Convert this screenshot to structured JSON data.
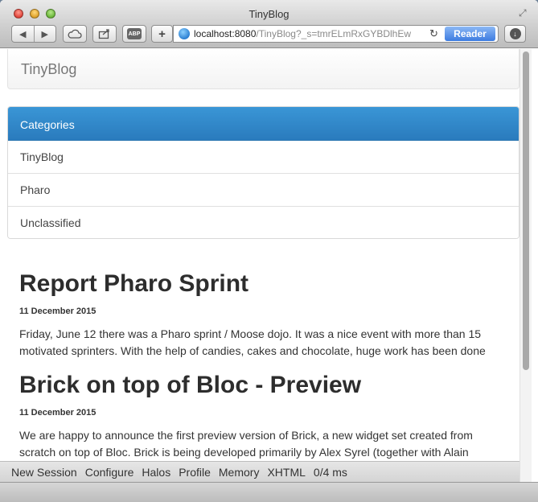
{
  "window": {
    "title": "TinyBlog"
  },
  "toolbar": {
    "url_host": "localhost:8080",
    "url_path": "/TinyBlog?_s=tmrELmRxGYBDlhEw",
    "reader_label": "Reader",
    "abp_label": "ABP"
  },
  "navbar": {
    "brand": "TinyBlog"
  },
  "categories": {
    "heading": "Categories",
    "items": [
      "TinyBlog",
      "Pharo",
      "Unclassified"
    ]
  },
  "posts": [
    {
      "title": "Report Pharo Sprint",
      "date": "11 December 2015",
      "body": "Friday, June 12 there was a Pharo sprint / Moose dojo. It was a nice event with more than 15 motivated sprinters. With the help of candies, cakes and chocolate, huge work has been done"
    },
    {
      "title": "Brick on top of Bloc - Preview",
      "date": "11 December 2015",
      "body": "We are happy to announce the first preview version of Brick, a new widget set created from scratch on top of Bloc. Brick is being developed primarily by Alex Syrel (together with Alain"
    }
  ],
  "devtools": {
    "items": [
      "New Session",
      "Configure",
      "Halos",
      "Profile",
      "Memory",
      "XHTML",
      "0/4 ms"
    ]
  }
}
